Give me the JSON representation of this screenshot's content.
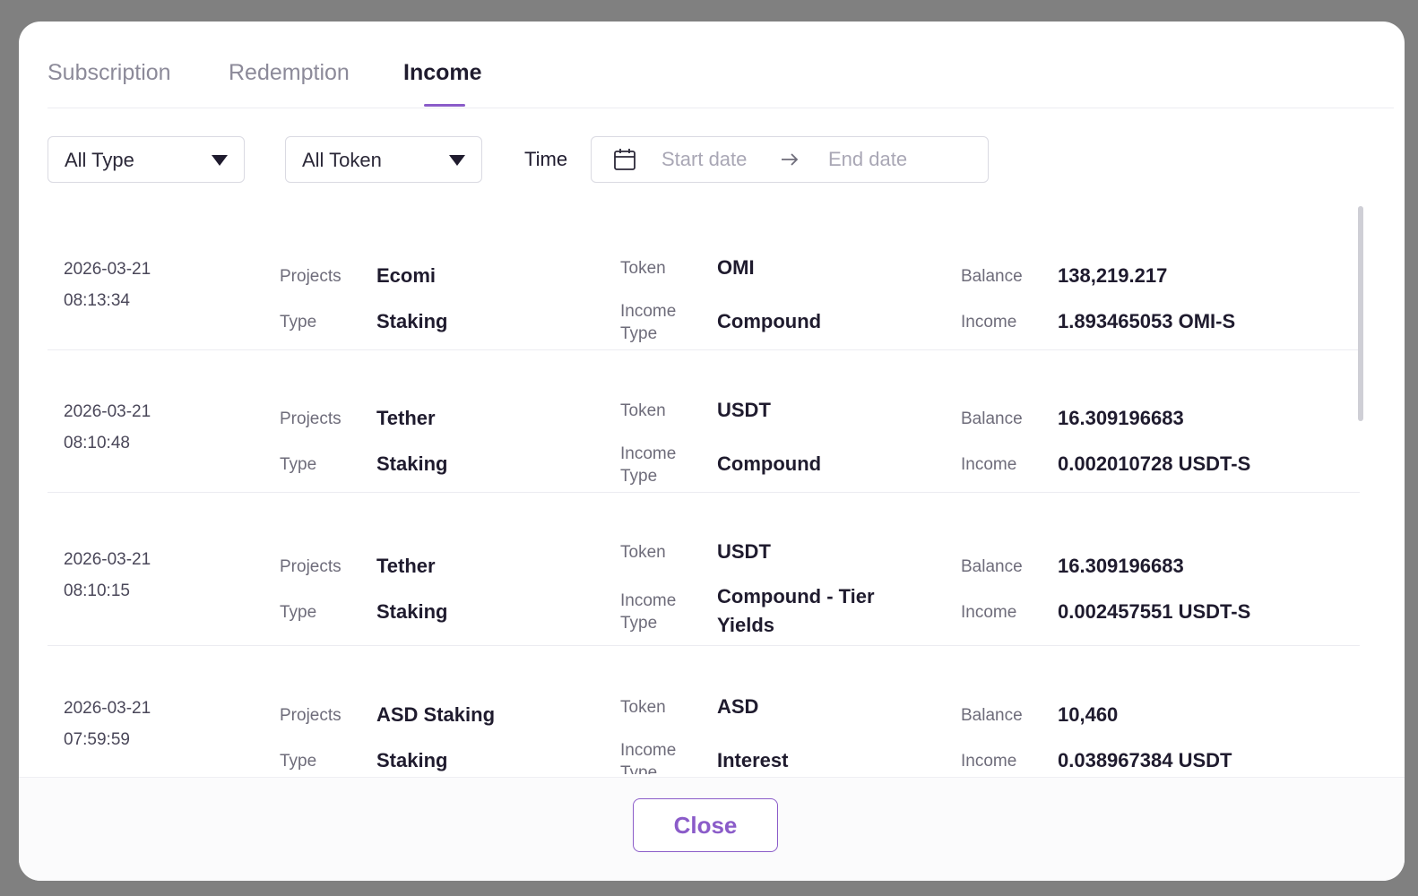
{
  "tabs": [
    {
      "label": "Subscription"
    },
    {
      "label": "Redemption"
    },
    {
      "label": "Income"
    }
  ],
  "filters": {
    "type_select": "All Type",
    "token_select": "All Token",
    "time_label": "Time",
    "start_placeholder": "Start date",
    "end_placeholder": "End date"
  },
  "labels": {
    "projects": "Projects",
    "type": "Type",
    "token": "Token",
    "income_type": "Income Type",
    "balance": "Balance",
    "income": "Income"
  },
  "records": [
    {
      "date": "2026-03-21",
      "time": "08:13:34",
      "project": "Ecomi",
      "type": "Staking",
      "token": "OMI",
      "income_type": "Compound",
      "balance": "138,219.217",
      "income": "1.893465053 OMI-S"
    },
    {
      "date": "2026-03-21",
      "time": "08:10:48",
      "project": "Tether",
      "type": "Staking",
      "token": "USDT",
      "income_type": "Compound",
      "balance": "16.309196683",
      "income": "0.002010728 USDT-S"
    },
    {
      "date": "2026-03-21",
      "time": "08:10:15",
      "project": "Tether",
      "type": "Staking",
      "token": "USDT",
      "income_type": "Compound - Tier Yields",
      "balance": "16.309196683",
      "income": "0.002457551 USDT-S"
    },
    {
      "date": "2026-03-21",
      "time": "07:59:59",
      "project": "ASD Staking",
      "type": "Staking",
      "token": "ASD",
      "income_type": "Interest",
      "balance": "10,460",
      "income": "0.038967384 USDT"
    }
  ],
  "footer": {
    "close_label": "Close"
  },
  "colors": {
    "accent": "#8b5cc9",
    "backdrop": "#808080"
  }
}
